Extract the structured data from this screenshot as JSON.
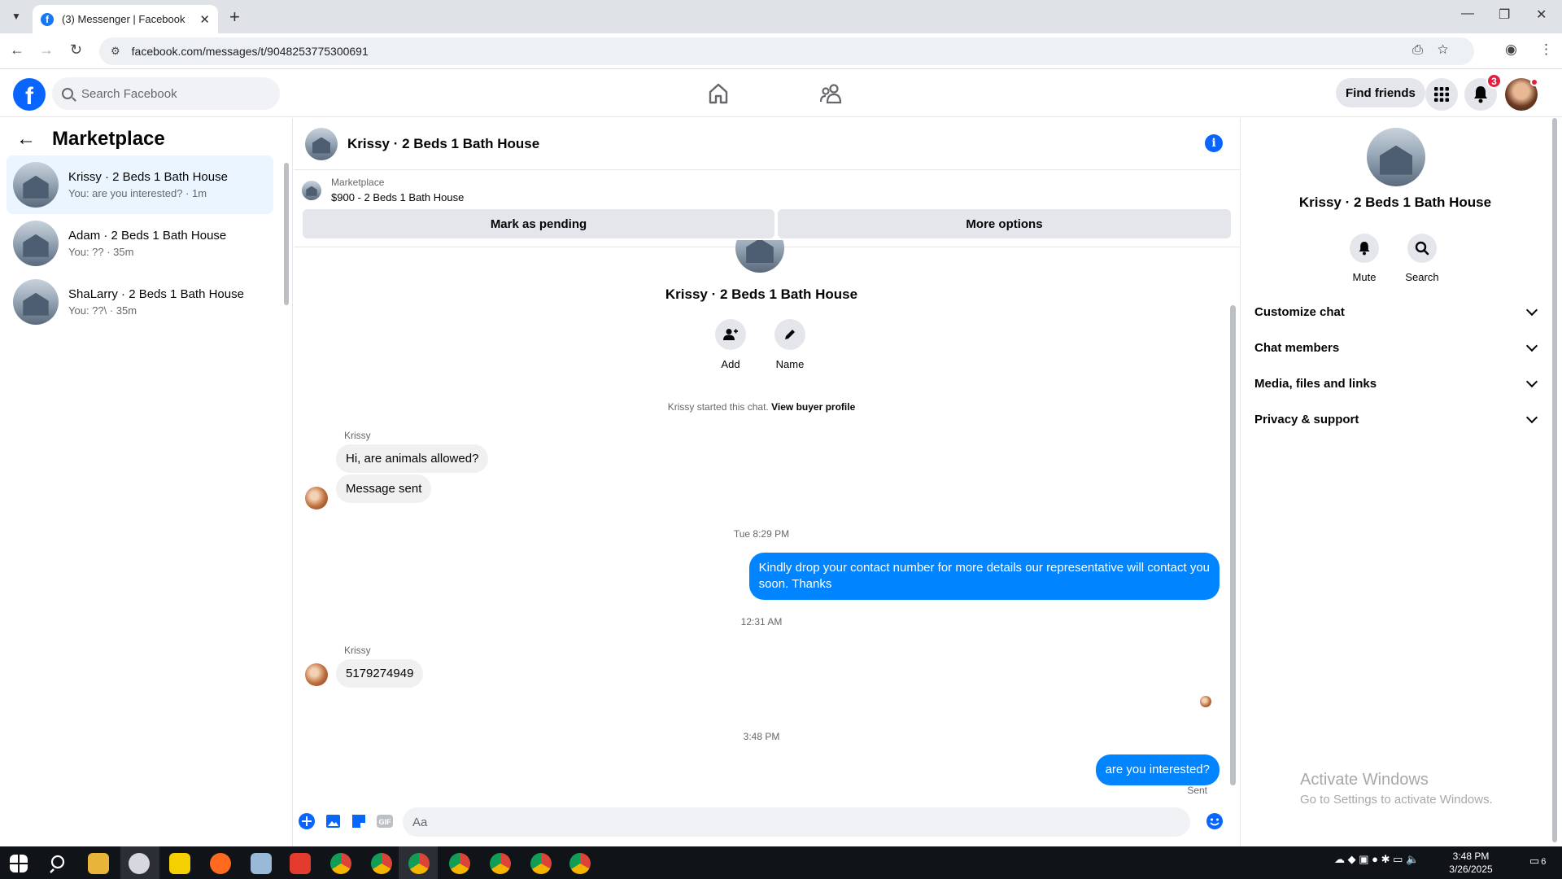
{
  "browser": {
    "tab_title": "(3) Messenger | Facebook",
    "url": "facebook.com/messages/t/9048253775300691"
  },
  "header": {
    "search_placeholder": "Search Facebook",
    "find_friends": "Find friends",
    "notification_count": "3"
  },
  "left_panel": {
    "title": "Marketplace",
    "conversations": [
      {
        "name": "Krissy · 2 Beds 1 Bath House",
        "preview": "You: are you interested? · 1m"
      },
      {
        "name": "Adam · 2 Beds 1 Bath House",
        "preview": "You: ?? · 35m"
      },
      {
        "name": "ShaLarry · 2 Beds 1 Bath House",
        "preview": "You: ??\\ · 35m"
      }
    ]
  },
  "chat": {
    "title": "Krissy · 2 Beds 1 Bath House",
    "marketplace_label": "Marketplace",
    "listing": "$900 - 2 Beds 1 Bath House",
    "mark_pending": "Mark as pending",
    "more_options": "More options",
    "center_name": "Krissy · 2 Beds 1 Bath House",
    "action_add": "Add",
    "action_name": "Name",
    "started_text": "Krissy started this chat.",
    "view_profile": "View buyer profile",
    "messages": [
      {
        "sender": "Krissy",
        "text": "Hi, are animals allowed?"
      },
      {
        "text": "Message sent"
      },
      {
        "timestamp": "Tue 8:29 PM"
      },
      {
        "text_line1": "Kindly drop your contact number for more details our representative will contact you",
        "text_line2": "soon. Thanks"
      },
      {
        "timestamp": "12:31 AM"
      },
      {
        "sender": "Krissy",
        "text": "5179274949"
      },
      {
        "timestamp": "3:48 PM"
      },
      {
        "text": "are you interested?"
      }
    ],
    "sent_status": "Sent",
    "composer_placeholder": "Aa"
  },
  "right_panel": {
    "name": "Krissy · 2 Beds 1 Bath House",
    "mute": "Mute",
    "search": "Search",
    "sections": [
      "Customize chat",
      "Chat members",
      "Media, files and links",
      "Privacy & support"
    ]
  },
  "watermark": {
    "line1": "Activate Windows",
    "line2": "Go to Settings to activate Windows."
  },
  "taskbar": {
    "time": "3:48 PM",
    "date": "3/26/2025",
    "notif_count": "6"
  },
  "colors": {
    "facebook_blue": "#0866ff",
    "outgoing_bubble": "#0084ff",
    "active_conversation": "#ebf5ff",
    "badge_red": "#e41e3f"
  }
}
